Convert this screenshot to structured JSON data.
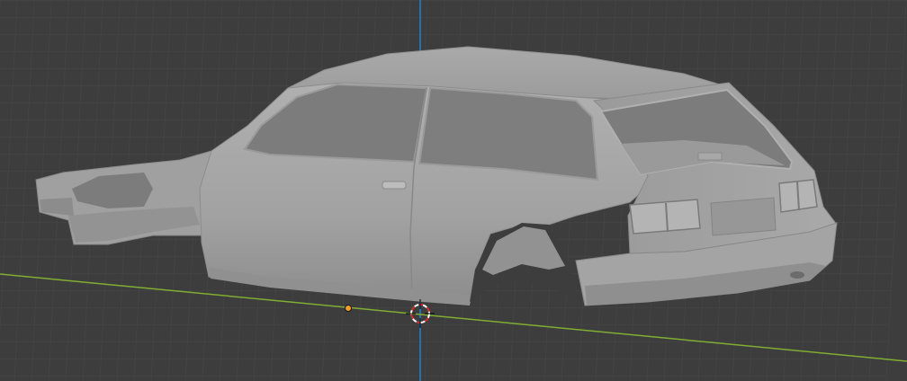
{
  "viewport": {
    "kind": "3D viewport",
    "background_color": "#3d3d3d",
    "grid_color": "#4a4a4a",
    "x_axis_color": "#8ab33c",
    "z_axis_color": "#2f6fa0",
    "object_body_color": "#a6a6a6",
    "object_shadow_color": "#8a8a8a",
    "glass_color": "#7e7e7e",
    "origin_dot_color": "#f0a030",
    "cursor_colors": [
      "#ffffff",
      "#d33030"
    ]
  },
  "scene": {
    "object": "car-body-hatchback",
    "origin_marker": "origin-dot",
    "cursor": "3d-cursor-icon"
  }
}
